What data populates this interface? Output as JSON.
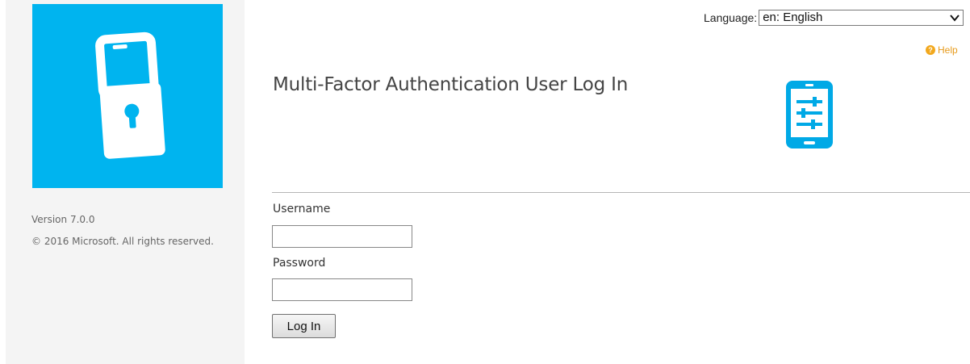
{
  "sidebar": {
    "version": "Version 7.0.0",
    "copyright": "© 2016 Microsoft. All rights reserved.",
    "logo_icon": "padlock-phone-icon",
    "logo_color": "#00b4ef"
  },
  "header": {
    "language_label": "Language:",
    "language_selected": "en: English",
    "help_label": "Help",
    "help_color": "#e79a1a"
  },
  "main": {
    "title": "Multi-Factor Authentication User Log In",
    "title_icon": "mobile-settings-icon",
    "username_label": "Username",
    "username_value": "",
    "password_label": "Password",
    "password_value": "",
    "login_button": "Log In"
  }
}
